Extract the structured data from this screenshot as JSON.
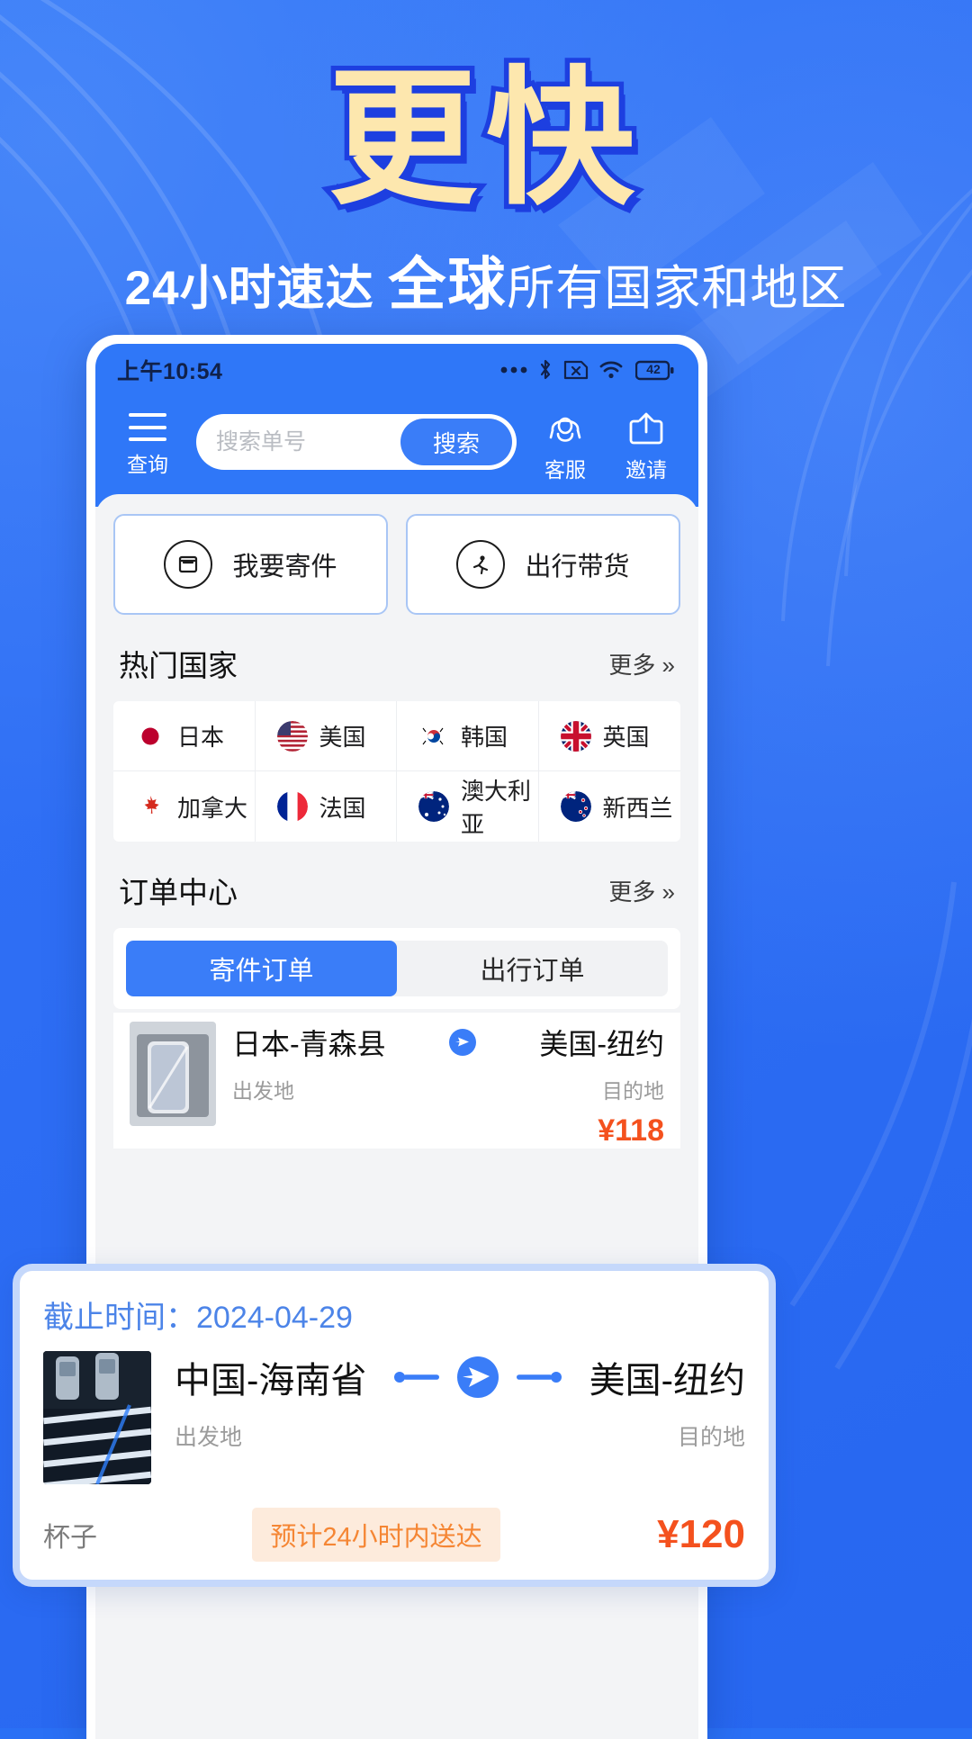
{
  "hero": {
    "title": "更快",
    "subtitle_part1": "24小时速达",
    "subtitle_strong": "全球",
    "subtitle_part2": "所有国家和地区",
    "title_color": "#fde7ae",
    "title_outline_color": "#1d3fe0",
    "background_color": "#2a70f5"
  },
  "statusbar": {
    "time": "上午10:54",
    "battery_level": "42",
    "icons": [
      "more-dots-icon",
      "bluetooth-icon",
      "sim-x-icon",
      "wifi-icon",
      "battery-icon"
    ]
  },
  "app_header": {
    "menu_label": "查询",
    "menu_icon": "hamburger-icon",
    "search_placeholder": "搜索单号",
    "search_value": "",
    "search_button": "搜索",
    "service_label": "客服",
    "service_icon": "headset-icon",
    "invite_label": "邀请",
    "invite_icon": "share-icon",
    "accent_color": "#3a7df8"
  },
  "quick_actions": [
    {
      "label": "我要寄件",
      "icon": "package-icon"
    },
    {
      "label": "出行带货",
      "icon": "runner-icon"
    }
  ],
  "hot_countries": {
    "title": "热门国家",
    "more": "更多 »",
    "items": [
      {
        "name": "日本",
        "flag": "flag-jp"
      },
      {
        "name": "美国",
        "flag": "flag-us"
      },
      {
        "name": "韩国",
        "flag": "flag-kr"
      },
      {
        "name": "英国",
        "flag": "flag-gb"
      },
      {
        "name": "加拿大",
        "flag": "flag-ca"
      },
      {
        "name": "法国",
        "flag": "flag-fr"
      },
      {
        "name": "澳大利亚",
        "flag": "flag-au"
      },
      {
        "name": "新西兰",
        "flag": "flag-nz"
      }
    ]
  },
  "order_center": {
    "title": "订单中心",
    "more": "更多 »",
    "tabs": [
      {
        "label": "寄件订单",
        "active": true
      },
      {
        "label": "出行订单",
        "active": false
      }
    ]
  },
  "highlight_order": {
    "deadline_label": "截止时间：",
    "deadline_value": "2024-04-29",
    "deadline_full": "截止时间：2024-04-29",
    "origin": "中国-海南省",
    "destination": "美国-纽约",
    "origin_label": "出发地",
    "destination_label": "目的地",
    "goods": "杯子",
    "badge": "预计24小时内送达",
    "price": "¥120",
    "transport_icon": "airplane-icon",
    "badge_text_color": "#f58634",
    "badge_bg_color": "#fdebdc",
    "price_color": "#f4511e",
    "deadline_color": "#4c84e8",
    "card_border_color": "#c5d8fb"
  },
  "background_order": {
    "origin": "日本-青森县",
    "destination": "美国-纽约",
    "origin_label": "出发地",
    "destination_label": "目的地",
    "price": "¥118"
  }
}
